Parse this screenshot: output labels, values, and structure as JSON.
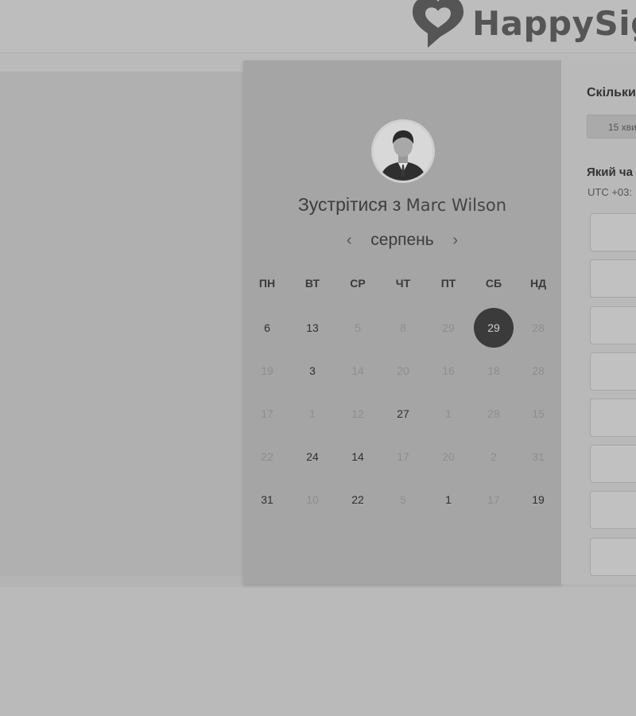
{
  "brand": {
    "logo_text": "HappySig"
  },
  "calendar": {
    "host_prefix": "Зустрітися з",
    "host_name": "Marc Wilson",
    "month": "серпень",
    "prev_icon": "chevron-left-icon",
    "next_icon": "chevron-right-icon",
    "weekdays": [
      "ПН",
      "ВТ",
      "СР",
      "ЧТ",
      "ПТ",
      "СБ",
      "НД"
    ],
    "weeks": [
      [
        {
          "t": "6",
          "s": "on"
        },
        {
          "t": "13",
          "s": "on"
        },
        {
          "t": "5",
          "s": "off"
        },
        {
          "t": "8",
          "s": "off"
        },
        {
          "t": "29",
          "s": "off"
        },
        {
          "t": "29",
          "s": "sel"
        },
        {
          "t": "28",
          "s": "off"
        }
      ],
      [
        {
          "t": "19",
          "s": "off"
        },
        {
          "t": "3",
          "s": "on"
        },
        {
          "t": "14",
          "s": "off"
        },
        {
          "t": "20",
          "s": "off"
        },
        {
          "t": "16",
          "s": "off"
        },
        {
          "t": "18",
          "s": "off"
        },
        {
          "t": "28",
          "s": "off"
        }
      ],
      [
        {
          "t": "17",
          "s": "off"
        },
        {
          "t": "1",
          "s": "off"
        },
        {
          "t": "12",
          "s": "off"
        },
        {
          "t": "27",
          "s": "on"
        },
        {
          "t": "1",
          "s": "off"
        },
        {
          "t": "28",
          "s": "off"
        },
        {
          "t": "15",
          "s": "off"
        }
      ],
      [
        {
          "t": "22",
          "s": "off"
        },
        {
          "t": "24",
          "s": "on"
        },
        {
          "t": "14",
          "s": "on"
        },
        {
          "t": "17",
          "s": "off"
        },
        {
          "t": "20",
          "s": "off"
        },
        {
          "t": "2",
          "s": "off"
        },
        {
          "t": "31",
          "s": "off"
        }
      ],
      [
        {
          "t": "31",
          "s": "on"
        },
        {
          "t": "10",
          "s": "off"
        },
        {
          "t": "22",
          "s": "on"
        },
        {
          "t": "5",
          "s": "off"
        },
        {
          "t": "1",
          "s": "on"
        },
        {
          "t": "17",
          "s": "off"
        },
        {
          "t": "19",
          "s": "on"
        }
      ]
    ]
  },
  "booking": {
    "duration_question": "Скільки",
    "duration_value": "15 хви",
    "time_question": "Який ча",
    "timezone": "UTC +03:"
  }
}
